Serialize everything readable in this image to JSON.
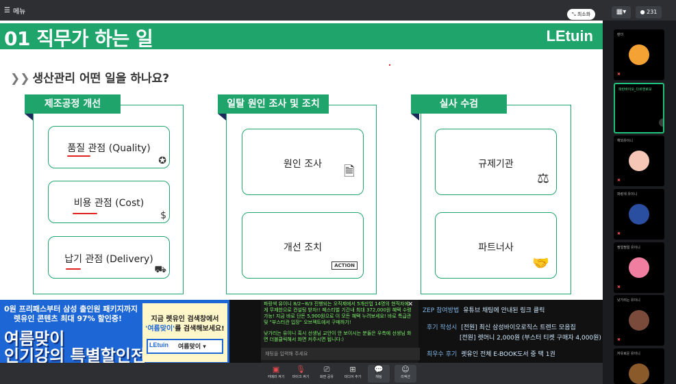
{
  "topbar": {
    "menu_label": "메뉴",
    "minimize_label": "최소화",
    "participant_count": "231"
  },
  "slide": {
    "title": "01 직무가 하는 일",
    "logo": "LEtuin",
    "subtitle": "생산관리 어떤 일을 하나요?",
    "panels": [
      {
        "header": "제조공정 개선",
        "items": [
          "품질 관점 (Quality)",
          "비용 관점 (Cost)",
          "납기 관점 (Delivery)"
        ]
      },
      {
        "header": "일탈 원인 조사 및 조치",
        "items": [
          "원인 조사",
          "개선 조치"
        ],
        "action_label": "ACTION"
      },
      {
        "header": "실사 수검",
        "items": [
          "규제기관",
          "파트너사"
        ]
      }
    ]
  },
  "banner": {
    "line1": "0원 프리패스부터 삼성 출인원 패키지까지",
    "line2": "렛유인 콘텐츠 최대 97% 할인중!",
    "big1": "여름맞이",
    "big2": "인기강의 특별할인전",
    "right_l1": "지금 렛유인 검색창에서",
    "right_l2_hl": "'여름맞이'",
    "right_l2_rest": "를 검색해보세요!",
    "search_logo": "LEtuin",
    "search_keyword": "여름맞이 ▾"
  },
  "chat": {
    "messages": [
      "파랑색 유이니 8/2~8/3 진행되는 오직제에서 5개산업 14명의 현직자에게 무제한으로 컨설팅 받자!! 페스티벌 기간내 최대 372,000원 혜택 수령가능! 지금 바로 단돈 5,900원으로 이 모든 혜택 누려보세요! 바로 특급관 및 \"부스터관 입장\" 오브젝트에서 구매하기!",
      "낮가리는 유이니 혹시 선생님 교안이 안 보이시는 분들은 우측에 선생님 화면 더블클릭해서 화면 커주시면 됩니다:)"
    ],
    "input_placeholder": "채팅을 입력해 주세요"
  },
  "info": [
    {
      "key": "ZEP 참여방법",
      "value": "유튜브 채팅에 안내된 링크 클릭"
    },
    {
      "key": "후기 작성시",
      "value": "[전원] 최신 삼성바이오로직스 트렌드 모음집"
    },
    {
      "key": "",
      "value": "[전원] 렛머니 2,000원 (부스터 티켓 구매자 4,000원)"
    },
    {
      "key": "최우수 후기",
      "value": "렛유인 전체 E-BOOK도서 중 택 1권"
    }
  ],
  "bottombar": {
    "buttons": [
      "카메라 켜기",
      "마이크 켜기",
      "화면 공유",
      "미디어 추가",
      "채팅",
      "리액션"
    ]
  },
  "participants": [
    {
      "name": "렌더"
    },
    {
      "name": "파란바이오_다르앤로보"
    },
    {
      "name": "해외유이니"
    },
    {
      "name": "파랑색 유이니"
    },
    {
      "name": "찡얼찡얼 유이니"
    },
    {
      "name": "낮가리는 유이니"
    },
    {
      "name": "자유로운 유이니"
    }
  ],
  "colors": {
    "brand_green": "#1fa46b",
    "banner_blue": "#1d66d6",
    "chat_green": "#7cf36a",
    "alert_red": "#e84b4b"
  }
}
